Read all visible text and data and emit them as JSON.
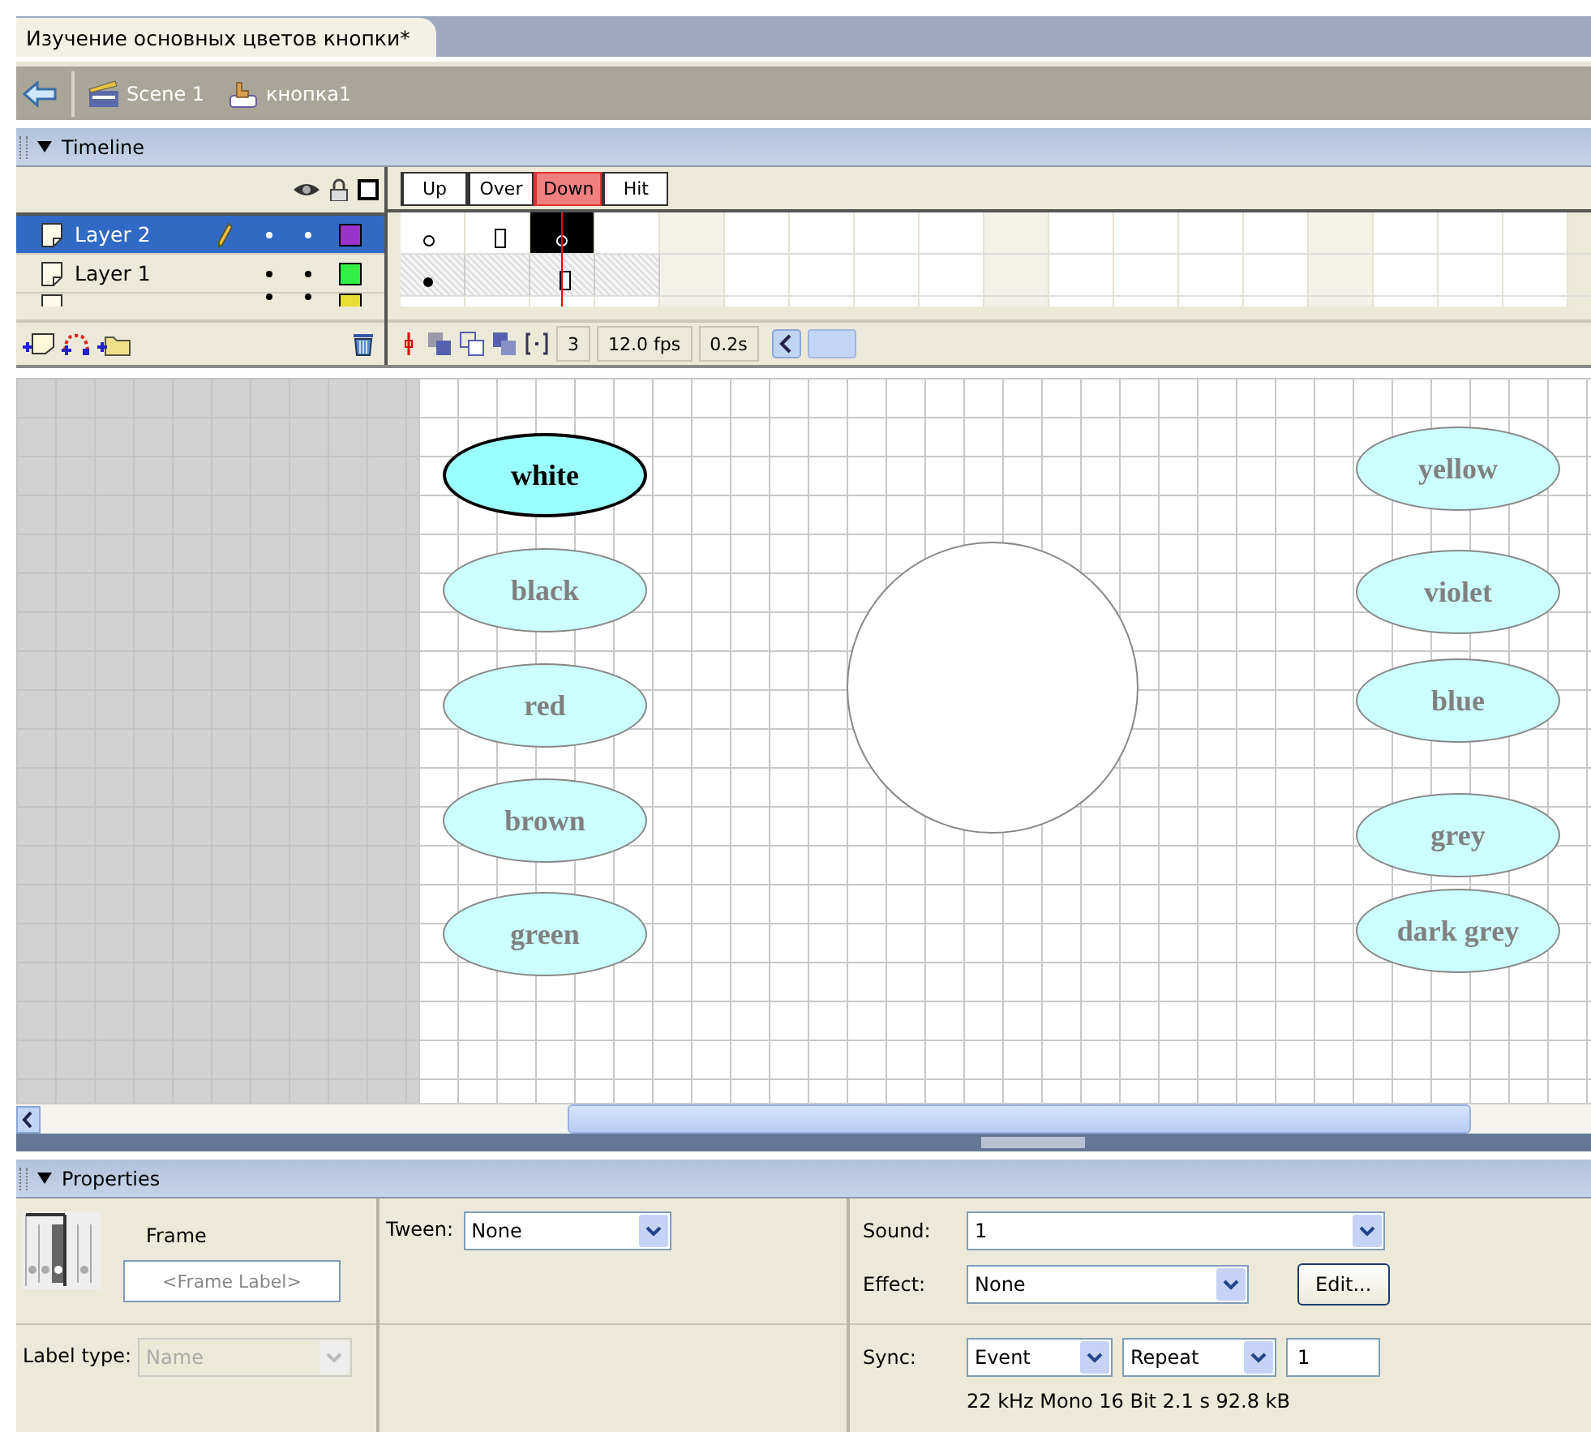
{
  "document_tab": {
    "title": "Изучение основных цветов кнопки*",
    "selected": true
  },
  "edit_bar": {
    "scene": "Scene 1",
    "symbol": "кнопка1"
  },
  "timeline": {
    "title": "Timeline",
    "expanded": true,
    "frame_states": [
      {
        "label": "Up",
        "selected": false
      },
      {
        "label": "Over",
        "selected": false
      },
      {
        "label": "Down",
        "selected": true
      },
      {
        "label": "Hit",
        "selected": false
      }
    ],
    "layers": [
      {
        "name": "Layer 2",
        "selected": true,
        "editing": true,
        "color": "#9933cc"
      },
      {
        "name": "Layer 1",
        "selected": false,
        "editing": false,
        "color": "#33ee44"
      },
      {
        "color": "#e8e030",
        "selected": false,
        "editing": false
      }
    ],
    "current_frame": "3",
    "frame_rate": "12.0 fps",
    "elapsed": "0.2s"
  },
  "stage": {
    "left_buttons": [
      {
        "label": "white",
        "selected": true
      },
      {
        "label": "black",
        "selected": false
      },
      {
        "label": "red",
        "selected": false
      },
      {
        "label": "brown",
        "selected": false
      },
      {
        "label": "green",
        "selected": false
      }
    ],
    "right_buttons": [
      {
        "label": "yellow",
        "selected": false
      },
      {
        "label": "violet",
        "selected": false
      },
      {
        "label": "blue",
        "selected": false
      },
      {
        "label": "grey",
        "selected": false
      },
      {
        "label": "dark grey",
        "selected": false
      }
    ]
  },
  "properties": {
    "title": "Properties",
    "expanded": true,
    "heading": "Frame",
    "frame_label_placeholder": "<Frame Label>",
    "label_type": {
      "label": "Label type:",
      "value": "Name",
      "disabled": true
    },
    "tween": {
      "label": "Tween:",
      "value": "None"
    },
    "sound": {
      "label": "Sound:",
      "value": "1"
    },
    "effect": {
      "label": "Effect:",
      "value": "None"
    },
    "edit_button": "Edit...",
    "sync": {
      "label": "Sync:",
      "value": "Event",
      "loop": "Repeat",
      "count": "1"
    },
    "sound_info": "22 kHz Mono 16 Bit 2.1 s 92.8 kB"
  }
}
